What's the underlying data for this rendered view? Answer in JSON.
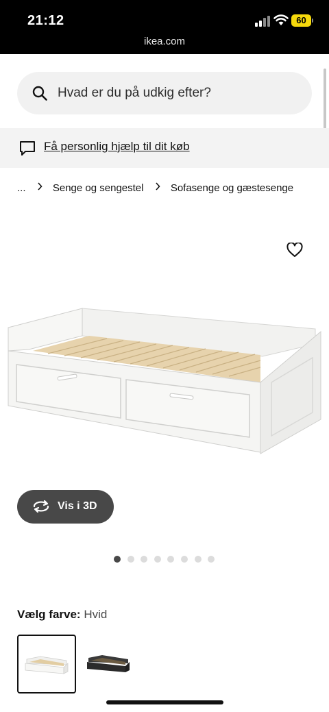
{
  "status_bar": {
    "time": "21:12",
    "domain": "ikea.com",
    "battery": "60",
    "battery_color": "#f6d90c"
  },
  "search": {
    "placeholder": "Hvad er du på udkig efter?",
    "icon": "search-icon"
  },
  "help_banner": {
    "text": "Få personlig hjælp til dit køb",
    "icon": "chat-bubble-icon"
  },
  "breadcrumb": {
    "ellipsis": "...",
    "items": [
      "Senge og sengestel",
      "Sofasenge og gæstesenge"
    ]
  },
  "product": {
    "favorite_icon": "heart-icon",
    "view_3d_label": "Vis i 3D",
    "view_3d_icon": "rotate-icon",
    "gallery": {
      "count": 8,
      "active_index": 0
    }
  },
  "color_select": {
    "label": "Vælg farve:",
    "selected": "Hvid",
    "options": [
      {
        "name": "Hvid",
        "color": "#f4f4f2",
        "selected": true
      },
      {
        "name": "Sort",
        "color": "#2b2b2b",
        "selected": false
      }
    ]
  },
  "colors": {
    "status_bar_bg": "#000000",
    "button_dark": "#484848",
    "search_bg": "#f1f1f1",
    "banner_bg": "#f3f3f3"
  }
}
